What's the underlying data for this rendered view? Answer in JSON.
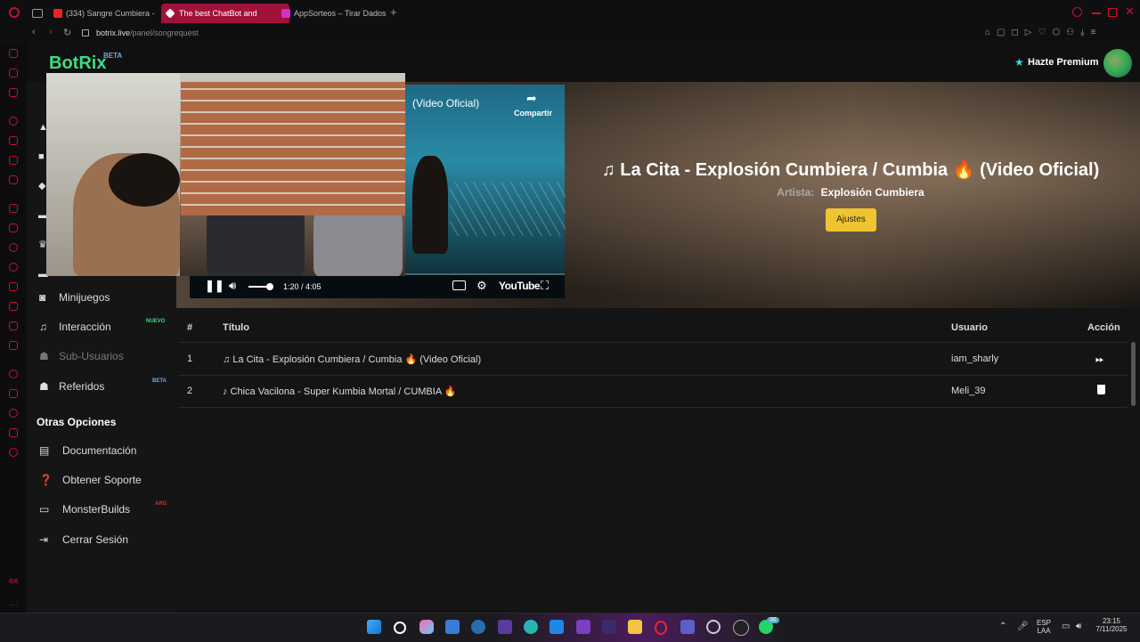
{
  "browser": {
    "tabs": [
      {
        "label": "(334) Sangre Cumbiera -"
      },
      {
        "label": "The best ChatBot and"
      },
      {
        "label": "AppSorteos – Tirar Dados"
      }
    ],
    "url_host": "botrix.live",
    "url_path": "/panel/songrequest"
  },
  "header": {
    "logo": "BotRix",
    "logo_badge": "BETA",
    "premium_label": "Hazte Premium"
  },
  "menu": {
    "items": [
      {
        "label": "Minijuegos",
        "badge": ""
      },
      {
        "label": "Interacción",
        "badge": "NUEVO"
      },
      {
        "label": "Sub-Usuarios",
        "badge": ""
      },
      {
        "label": "Referidos",
        "badge": "BETA"
      }
    ],
    "section_title": "Otras Opciones",
    "other_items": [
      {
        "label": "Documentación"
      },
      {
        "label": "Obtener Soporte"
      },
      {
        "label": "MonsterBuilds",
        "badge": "ARG"
      },
      {
        "label": "Cerrar Sesión"
      }
    ]
  },
  "player": {
    "video_title": "(Video Oficial)",
    "share_label": "Compartir",
    "time": "1:20 / 4:05",
    "brand": "YouTube",
    "progress": 0.33,
    "volume": 0.8
  },
  "now_playing": {
    "title": "♫ La Cita - Explosión Cumbiera / Cumbia 🔥 (Video Oficial)",
    "artist_label": "Artista:",
    "artist": "Explosión Cumbiera",
    "settings_button": "Ajustes"
  },
  "queue": {
    "headers": {
      "num": "#",
      "title": "Título",
      "user": "Usuario",
      "action": "Acción"
    },
    "rows": [
      {
        "num": "1",
        "title": "♫ La Cita - Explosión Cumbiera / Cumbia 🔥 (Video Oficial)",
        "user": "iam_sharly",
        "action_icon": "skip-icon"
      },
      {
        "num": "2",
        "title": "♪ Chica Vacilona - Super Kumbia Mortal / CUMBIA 🔥",
        "user": "Meli_39",
        "action_icon": "trash-icon"
      }
    ]
  },
  "taskbar": {
    "lang_top": "ESP",
    "lang_bottom": "LAA",
    "time": "23:15",
    "date": "7/11/2025",
    "whatsapp_badge": "36"
  },
  "colors": {
    "accent_green": "#3ddc84",
    "button_yellow": "#f0c430",
    "opera_red": "#c8102e"
  }
}
